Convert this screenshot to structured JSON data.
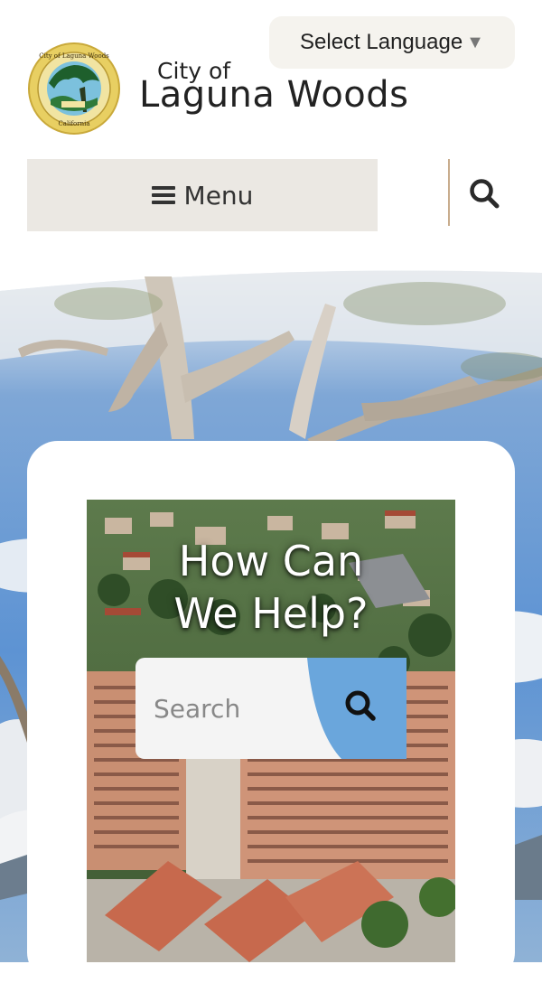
{
  "header": {
    "language_select_label": "Select Language",
    "language_caret": "▼",
    "brand_small": "City of",
    "brand_large": "Laguna Woods"
  },
  "nav": {
    "menu_label": "Menu",
    "menu_icon": "hamburger-icon",
    "search_icon": "search-icon"
  },
  "help": {
    "title": "How Can\nWe Help?",
    "search_placeholder": "Search",
    "search_icon": "search-icon"
  },
  "colors": {
    "menu_bg": "#ebe8e3",
    "language_bg": "#f5f3ee",
    "divider": "#c9ad8d",
    "search_accent": "#6aa6dc",
    "seal_ring": "#e2c85a",
    "seal_green": "#1e5f2c"
  }
}
